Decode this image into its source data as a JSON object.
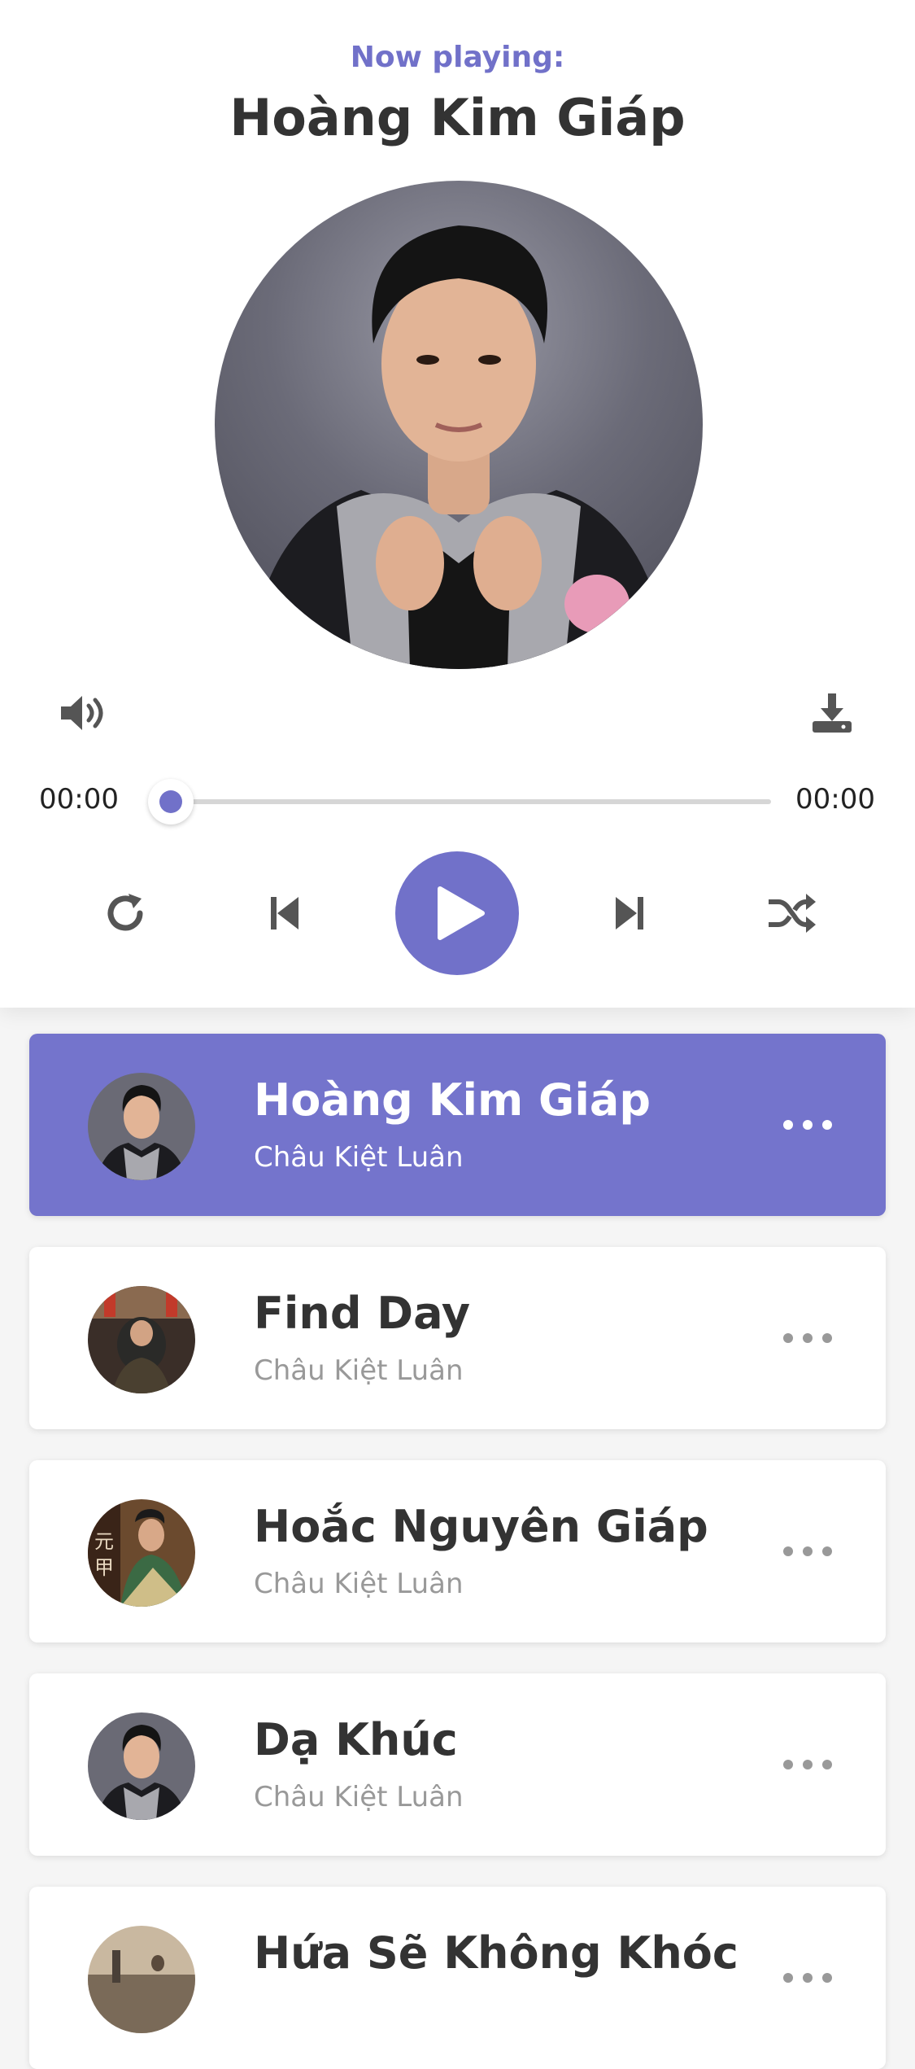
{
  "header": {
    "label": "Now playing:",
    "title": "Hoàng Kim Giáp"
  },
  "progress": {
    "current_time": "00:00",
    "duration": "00:00",
    "fraction": 0
  },
  "icons": {
    "volume": "volume-icon",
    "download": "download-icon",
    "repeat": "repeat-icon",
    "previous": "previous-icon",
    "play": "play-icon",
    "next": "next-icon",
    "shuffle": "shuffle-icon",
    "more": "more-icon"
  },
  "colors": {
    "accent": "#7171c9",
    "active_item": "#7474cc"
  },
  "playlist": [
    {
      "title": "Hoàng Kim Giáp",
      "artist": "Châu Kiệt Luân",
      "active": true
    },
    {
      "title": "Find Day",
      "artist": "Châu Kiệt Luân",
      "active": false
    },
    {
      "title": "Hoắc Nguyên Giáp",
      "artist": "Châu Kiệt Luân",
      "active": false
    },
    {
      "title": "Dạ Khúc",
      "artist": "Châu Kiệt Luân",
      "active": false
    },
    {
      "title": "Hứa Sẽ Không Khóc",
      "artist": "",
      "active": false
    }
  ]
}
